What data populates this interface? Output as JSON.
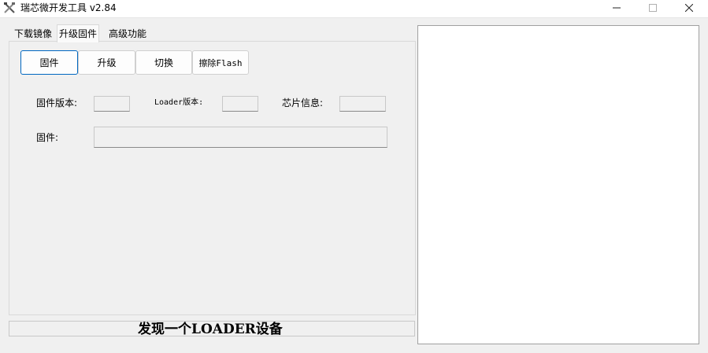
{
  "window": {
    "title": "瑞芯微开发工具 v2.84",
    "icon": "crossed-tools-icon",
    "controls": [
      "minimize-icon",
      "maximize-icon",
      "close-icon"
    ]
  },
  "tabs": [
    {
      "label": "下载镜像",
      "active": false
    },
    {
      "label": "升级固件",
      "active": true
    },
    {
      "label": "高级功能",
      "active": false
    }
  ],
  "toolbar": {
    "firmware_label": "固件",
    "upgrade_label": "升级",
    "switch_label": "切换",
    "erase_label": "擦除Flash"
  },
  "info": {
    "firmware_version_label": "固件版本:",
    "firmware_version_value": "",
    "loader_version_label": "Loader版本:",
    "loader_version_value": "",
    "chip_info_label": "芯片信息:",
    "chip_info_value": "",
    "firmware_path_label": "固件:",
    "firmware_path_value": ""
  },
  "status": {
    "text": "发现一个LOADER设备"
  },
  "log": {
    "content": ""
  }
}
